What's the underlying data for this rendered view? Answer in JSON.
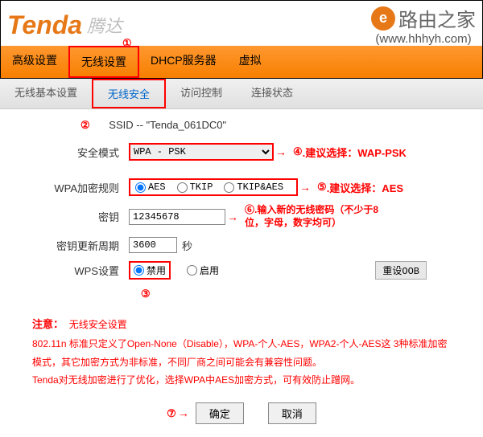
{
  "logo": {
    "brand": "Tenda",
    "brand_cn": "腾达"
  },
  "watermark": {
    "title": "路由之家",
    "url": "(www.hhhyh.com)"
  },
  "nav_main": [
    "高级设置",
    "无线设置",
    "DHCP服务器",
    "虚拟"
  ],
  "nav_sub": [
    "无线基本设置",
    "无线安全",
    "访问控制",
    "连接状态"
  ],
  "ssid": {
    "label": "SSID -- ",
    "value": "\"Tenda_061DC0\""
  },
  "security_mode": {
    "label": "安全模式",
    "value": "WPA - PSK"
  },
  "wpa_rule": {
    "label": "WPA加密规则",
    "options": [
      "AES",
      "TKIP",
      "TKIP&AES"
    ],
    "selected": "AES"
  },
  "key": {
    "label": "密钥",
    "value": "12345678"
  },
  "refresh": {
    "label": "密钥更新周期",
    "value": "3600",
    "unit": "秒"
  },
  "wps": {
    "label": "WPS设置",
    "options": [
      "禁用",
      "启用"
    ],
    "selected": "禁用"
  },
  "reset_btn": "重设OOB",
  "annotations": {
    "m1": "①",
    "m2": "②",
    "m3": "③",
    "m4": "④",
    "m5": "⑤",
    "m6": "⑥",
    "m7": "⑦",
    "a4": ".建议选择：WAP-PSK",
    "a5": ".建议选择：AES",
    "a6": ".输入新的无线密码（不少于8位，字母，数字均可）"
  },
  "notice": {
    "title": "注意：",
    "subtitle": "无线安全设置",
    "line1": "802.11n 标准只定义了Open-None（Disable），WPA-个人-AES，WPA2-个人-AES这 3种标准加密模式，其它加密方式为非标准，不同厂商之间可能会有兼容性问题。",
    "line2": "Tenda对无线加密进行了优化，选择WPA中AES加密方式，可有效防止蹭网。"
  },
  "buttons": {
    "ok": "确定",
    "cancel": "取消"
  }
}
